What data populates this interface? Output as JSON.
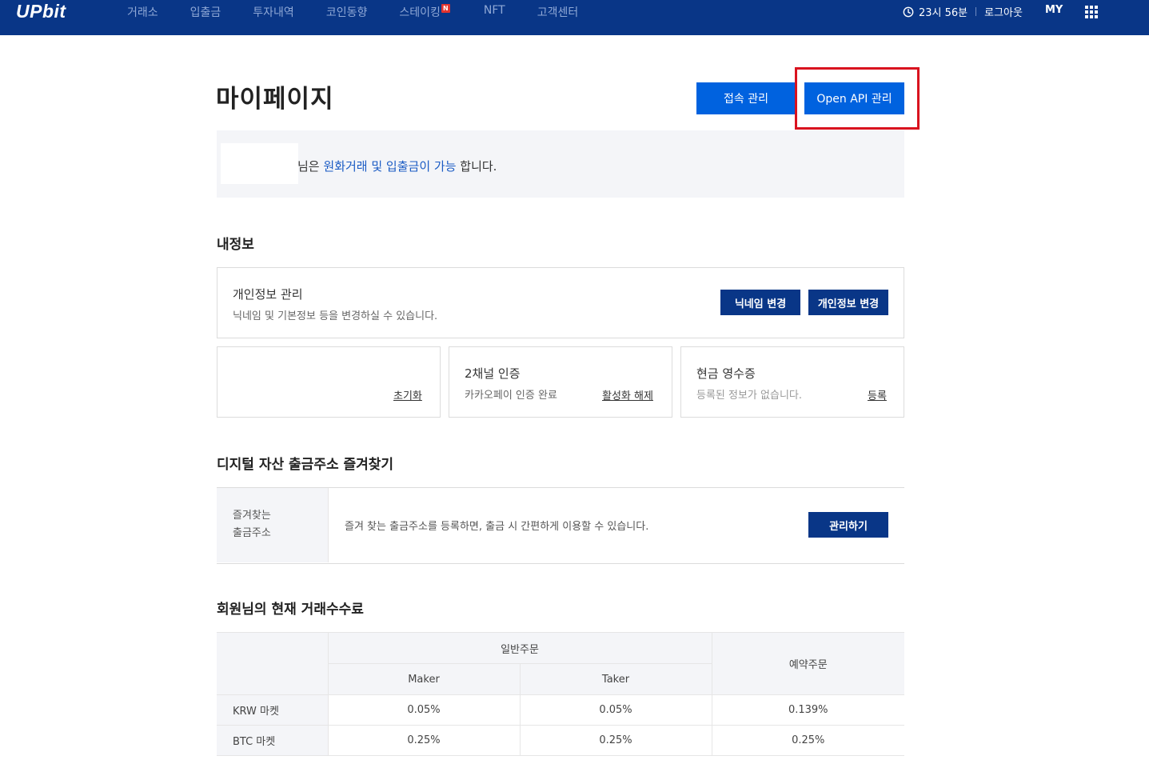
{
  "topbar": {
    "logo": "UPbit",
    "nav": [
      {
        "label": "거래소"
      },
      {
        "label": "입출금"
      },
      {
        "label": "투자내역"
      },
      {
        "label": "코인동향"
      },
      {
        "label": "스테이킹",
        "badge": "N"
      },
      {
        "label": "NFT"
      },
      {
        "label": "고객센터"
      }
    ],
    "time": "23시 56분",
    "logout": "로그아웃",
    "my": "MY",
    "colors": {
      "bar": "#093687",
      "nav_text": "#8fa8d6",
      "badge": "#e3342f"
    }
  },
  "header": {
    "title": "마이페이지",
    "access_button": "접속 관리",
    "api_button": "Open API 관리"
  },
  "status": {
    "prefix": "님은",
    "highlight": "원화거래 및 입출금이 가능",
    "suffix": "합니다."
  },
  "my_info": {
    "section_title": "내정보",
    "personal": {
      "title": "개인정보 관리",
      "desc": "닉네임 및 기본정보 등을 변경하실 수 있습니다.",
      "nickname_button": "닉네임 변경",
      "info_button": "개인정보 변경"
    },
    "reset_link": "초기화",
    "two_factor": {
      "title": "2채널 인증",
      "desc": "카카오페이 인증 완료",
      "link": "활성화 해제"
    },
    "receipt": {
      "title": "현금 영수증",
      "desc": "등록된 정보가 없습니다.",
      "link": "등록"
    }
  },
  "favorites": {
    "section_title": "디지털 자산 출금주소 즐겨찾기",
    "head_line1": "즐겨찾는",
    "head_line2": "출금주소",
    "desc": "즐겨 찾는 출금주소를 등록하면, 출금 시 간편하게 이용할 수 있습니다.",
    "button": "관리하기"
  },
  "fees": {
    "section_title": "회원님의 현재 거래수수료",
    "group_header": "일반주문",
    "reserved_header": "예약주문",
    "maker_header": "Maker",
    "taker_header": "Taker",
    "rows": [
      {
        "market": "KRW 마켓",
        "maker": "0.05%",
        "taker": "0.05%",
        "reserved": "0.139%"
      },
      {
        "market": "BTC 마켓",
        "maker": "0.25%",
        "taker": "0.25%",
        "reserved": "0.25%"
      }
    ]
  },
  "colors": {
    "accent_blue": "#0062df",
    "navy": "#093687",
    "highlight_red": "#d9131f",
    "link_blue": "#1a5bc4"
  }
}
